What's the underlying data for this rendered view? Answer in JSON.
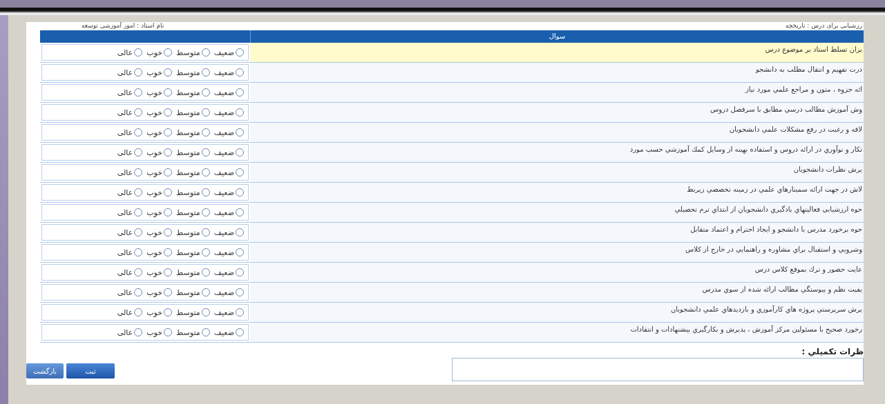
{
  "header": {
    "course": "رزشیابی برای درس : تاریخچه",
    "teacher": "نام استاد : امور آموزشی توسعه"
  },
  "table": {
    "columns": [
      "سوال"
    ],
    "rows": [
      {
        "question": "یزان تسلط استاد بر موضوع درس",
        "highlighted": true,
        "options": [
          {
            "label": "ضعیف",
            "checked": false
          },
          {
            "label": "متوسط",
            "checked": false
          },
          {
            "label": "خوب",
            "checked": false
          },
          {
            "label": "عالی",
            "checked": false
          }
        ]
      },
      {
        "question": "درت تفهیم و انتقال مطلب به دانشجو",
        "highlighted": false,
        "options": [
          {
            "label": "ضعیف",
            "checked": false
          },
          {
            "label": "متوسط",
            "checked": false
          },
          {
            "label": "خوب",
            "checked": false
          },
          {
            "label": "عالی",
            "checked": false
          }
        ]
      },
      {
        "question": "ائه جزوه ، متون و مراجع علمي مورد نیاز",
        "highlighted": false,
        "options": [
          {
            "label": "ضعیف",
            "checked": false
          },
          {
            "label": "متوسط",
            "checked": false
          },
          {
            "label": "خوب",
            "checked": false
          },
          {
            "label": "عالی",
            "checked": false
          }
        ]
      },
      {
        "question": "وش آموزش مطالب درسي مطابق با سرفصل دروس",
        "highlighted": false,
        "options": [
          {
            "label": "ضعیف",
            "checked": false
          },
          {
            "label": "متوسط",
            "checked": false
          },
          {
            "label": "خوب",
            "checked": false
          },
          {
            "label": "عالی",
            "checked": false
          }
        ]
      },
      {
        "question": "لاقه و رغبت در رفع مشکلات علمي دانشجویان",
        "highlighted": false,
        "options": [
          {
            "label": "ضعیف",
            "checked": false
          },
          {
            "label": "متوسط",
            "checked": false
          },
          {
            "label": "خوب",
            "checked": false
          },
          {
            "label": "عالی",
            "checked": false
          }
        ]
      },
      {
        "question": "تکار و نوآوري در ارائه دروس و استفاده بهینه از وسایل کمك آموزشي حسب مورد",
        "highlighted": false,
        "options": [
          {
            "label": "ضعیف",
            "checked": false
          },
          {
            "label": "متوسط",
            "checked": false
          },
          {
            "label": "خوب",
            "checked": false
          },
          {
            "label": "عالی",
            "checked": false
          }
        ]
      },
      {
        "question": "یرش نظرات دانشجویان",
        "highlighted": false,
        "options": [
          {
            "label": "ضعیف",
            "checked": false
          },
          {
            "label": "متوسط",
            "checked": false
          },
          {
            "label": "خوب",
            "checked": false
          },
          {
            "label": "عالی",
            "checked": false
          }
        ]
      },
      {
        "question": "لاش در جهت ارائه سمینارهاي علمي در زمینه تخصصي زیربط",
        "highlighted": false,
        "options": [
          {
            "label": "ضعیف",
            "checked": false
          },
          {
            "label": "متوسط",
            "checked": false
          },
          {
            "label": "خوب",
            "checked": false
          },
          {
            "label": "عالی",
            "checked": false
          }
        ]
      },
      {
        "question": "حوه ارزشیابی فعالیتهاي یادگیري دانشجویان از ابتداي ترم تحصیلي",
        "highlighted": false,
        "options": [
          {
            "label": "ضعیف",
            "checked": false
          },
          {
            "label": "متوسط",
            "checked": false
          },
          {
            "label": "خوب",
            "checked": false
          },
          {
            "label": "عالی",
            "checked": false
          }
        ]
      },
      {
        "question": "حوه برخورد مدرس با دانشجو و ایجاد احترام و اعتماد متقابل",
        "highlighted": false,
        "options": [
          {
            "label": "ضعیف",
            "checked": false
          },
          {
            "label": "متوسط",
            "checked": false
          },
          {
            "label": "خوب",
            "checked": false
          },
          {
            "label": "عالی",
            "checked": false
          }
        ]
      },
      {
        "question": "وشرویي و استقبال براي مشاوره و راهنمایي در خارج از کلاس",
        "highlighted": false,
        "options": [
          {
            "label": "ضعیف",
            "checked": false
          },
          {
            "label": "متوسط",
            "checked": false
          },
          {
            "label": "خوب",
            "checked": false
          },
          {
            "label": "عالی",
            "checked": false
          }
        ]
      },
      {
        "question": "عایت حضور و ترك بموقع کلاس درس",
        "highlighted": false,
        "options": [
          {
            "label": "ضعیف",
            "checked": false
          },
          {
            "label": "متوسط",
            "checked": false
          },
          {
            "label": "خوب",
            "checked": false
          },
          {
            "label": "عالی",
            "checked": false
          }
        ]
      },
      {
        "question": "یفیت نظم و پیوستگي مطالب ارائه شده از سوي مدرس",
        "highlighted": false,
        "options": [
          {
            "label": "ضعیف",
            "checked": false
          },
          {
            "label": "متوسط",
            "checked": false
          },
          {
            "label": "خوب",
            "checked": false
          },
          {
            "label": "عالی",
            "checked": false
          }
        ]
      },
      {
        "question": "یرش سرپرستي پروژه هاي کارآموزي و بازدیدهاي علمي دانشجویان",
        "highlighted": false,
        "options": [
          {
            "label": "ضعیف",
            "checked": false
          },
          {
            "label": "متوسط",
            "checked": false
          },
          {
            "label": "خوب",
            "checked": false
          },
          {
            "label": "عالی",
            "checked": false
          }
        ]
      },
      {
        "question": "رخورد صحیح با مسئولین مرکز آموزش ، پذیرش و بکارگیري پیشنهادات و انتقادات",
        "highlighted": false,
        "options": [
          {
            "label": "ضعیف",
            "checked": false
          },
          {
            "label": "متوسط",
            "checked": false
          },
          {
            "label": "خوب",
            "checked": false
          },
          {
            "label": "عالی",
            "checked": false
          }
        ]
      }
    ]
  },
  "comments": {
    "label": "ظرات تكميلي :"
  },
  "buttons": [
    {
      "label": "ثبت",
      "kind": "primary"
    },
    {
      "label": "بازگشت",
      "kind": "secondary"
    }
  ]
}
